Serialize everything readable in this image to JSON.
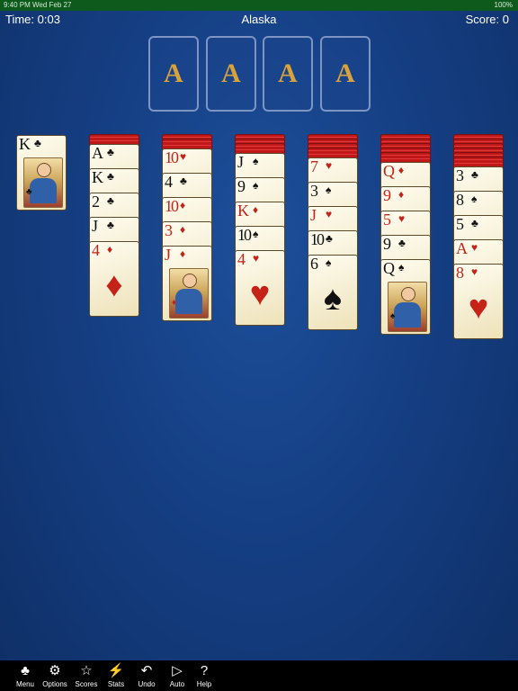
{
  "status": {
    "time": "9:40 PM  Wed Feb 27",
    "battery": "100%"
  },
  "header": {
    "time": "Time: 0:03",
    "title": "Alaska",
    "score": "Score: 0"
  },
  "foundations": [
    "A",
    "A",
    "A",
    "A"
  ],
  "stock": {
    "rank": "K",
    "suit": "♣",
    "color": "blk",
    "court": true
  },
  "columns": [
    {
      "backs": 1,
      "cards": [
        {
          "rank": "A",
          "suit": "♣",
          "color": "blk"
        },
        {
          "rank": "K",
          "suit": "♣",
          "color": "blk"
        },
        {
          "rank": "2",
          "suit": "♣",
          "color": "blk"
        },
        {
          "rank": "J",
          "suit": "♣",
          "color": "blk"
        },
        {
          "rank": "4",
          "suit": "♦",
          "color": "red"
        }
      ]
    },
    {
      "backs": 2,
      "cards": [
        {
          "rank": "10",
          "suit": "♥",
          "color": "red"
        },
        {
          "rank": "4",
          "suit": "♣",
          "color": "blk"
        },
        {
          "rank": "10",
          "suit": "♦",
          "color": "red"
        },
        {
          "rank": "3",
          "suit": "♦",
          "color": "red"
        },
        {
          "rank": "J",
          "suit": "♦",
          "color": "red",
          "court": true
        }
      ]
    },
    {
      "backs": 3,
      "cards": [
        {
          "rank": "J",
          "suit": "♠",
          "color": "blk"
        },
        {
          "rank": "9",
          "suit": "♠",
          "color": "blk"
        },
        {
          "rank": "K",
          "suit": "♦",
          "color": "red"
        },
        {
          "rank": "10",
          "suit": "♠",
          "color": "blk"
        },
        {
          "rank": "4",
          "suit": "♥",
          "color": "red"
        }
      ]
    },
    {
      "backs": 4,
      "cards": [
        {
          "rank": "7",
          "suit": "♥",
          "color": "red"
        },
        {
          "rank": "3",
          "suit": "♠",
          "color": "blk"
        },
        {
          "rank": "J",
          "suit": "♥",
          "color": "red"
        },
        {
          "rank": "10",
          "suit": "♣",
          "color": "blk"
        },
        {
          "rank": "6",
          "suit": "♠",
          "color": "blk"
        }
      ]
    },
    {
      "backs": 5,
      "cards": [
        {
          "rank": "Q",
          "suit": "♦",
          "color": "red"
        },
        {
          "rank": "9",
          "suit": "♦",
          "color": "red"
        },
        {
          "rank": "5",
          "suit": "♥",
          "color": "red"
        },
        {
          "rank": "9",
          "suit": "♣",
          "color": "blk"
        },
        {
          "rank": "Q",
          "suit": "♠",
          "color": "blk",
          "court": true
        }
      ]
    },
    {
      "backs": 6,
      "cards": [
        {
          "rank": "3",
          "suit": "♣",
          "color": "blk"
        },
        {
          "rank": "8",
          "suit": "♠",
          "color": "blk"
        },
        {
          "rank": "5",
          "suit": "♣",
          "color": "blk"
        },
        {
          "rank": "A",
          "suit": "♥",
          "color": "red"
        },
        {
          "rank": "8",
          "suit": "♥",
          "color": "red"
        }
      ]
    }
  ],
  "toolbar": [
    {
      "label": "Menu",
      "icon": "menu-icon",
      "glyph": "♣"
    },
    {
      "label": "Options",
      "icon": "gear-icon",
      "glyph": "⚙"
    },
    {
      "label": "Scores",
      "icon": "star-icon",
      "glyph": "☆"
    },
    {
      "label": "Stats",
      "icon": "chart-icon",
      "glyph": "⚡"
    },
    {
      "label": "Undo",
      "icon": "undo-icon",
      "glyph": "↶"
    },
    {
      "label": "Auto",
      "icon": "fast-forward-icon",
      "glyph": "▷"
    },
    {
      "label": "Help",
      "icon": "question-icon",
      "glyph": "?"
    }
  ]
}
